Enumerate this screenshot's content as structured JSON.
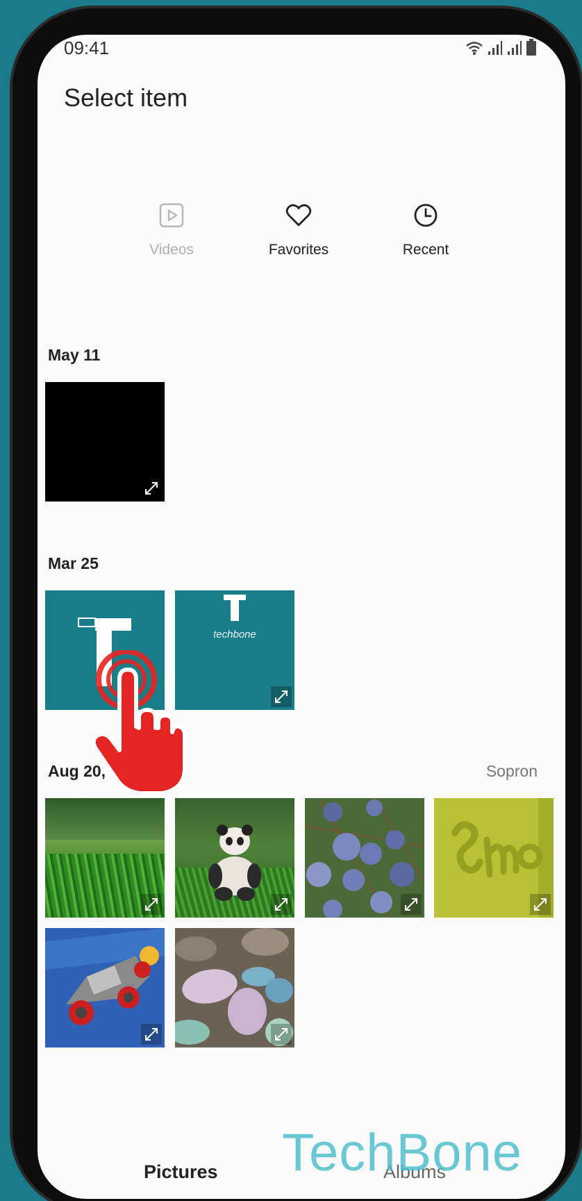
{
  "status_bar": {
    "time": "09:41"
  },
  "header": {
    "title": "Select item"
  },
  "categories": [
    {
      "label": "Videos",
      "icon": "video-icon",
      "enabled": false
    },
    {
      "label": "Favorites",
      "icon": "heart-icon",
      "enabled": true
    },
    {
      "label": "Recent",
      "icon": "clock-icon",
      "enabled": true
    }
  ],
  "sections": [
    {
      "date": "May 11",
      "location": ""
    },
    {
      "date": "Mar 25",
      "location": ""
    },
    {
      "date": "Aug 20,",
      "location": "Sopron"
    }
  ],
  "thumbs": {
    "techbone_caption": "techbone",
    "techbone_letter": "T"
  },
  "bottom_tabs": {
    "pictures": "Pictures",
    "albums": "Albums"
  },
  "watermark": "TechBone",
  "colors": {
    "background": "#1a7a8a",
    "screen": "#fafafa",
    "teal_thumb": "#1a7d8a",
    "tap_indicator": "#e52521"
  }
}
